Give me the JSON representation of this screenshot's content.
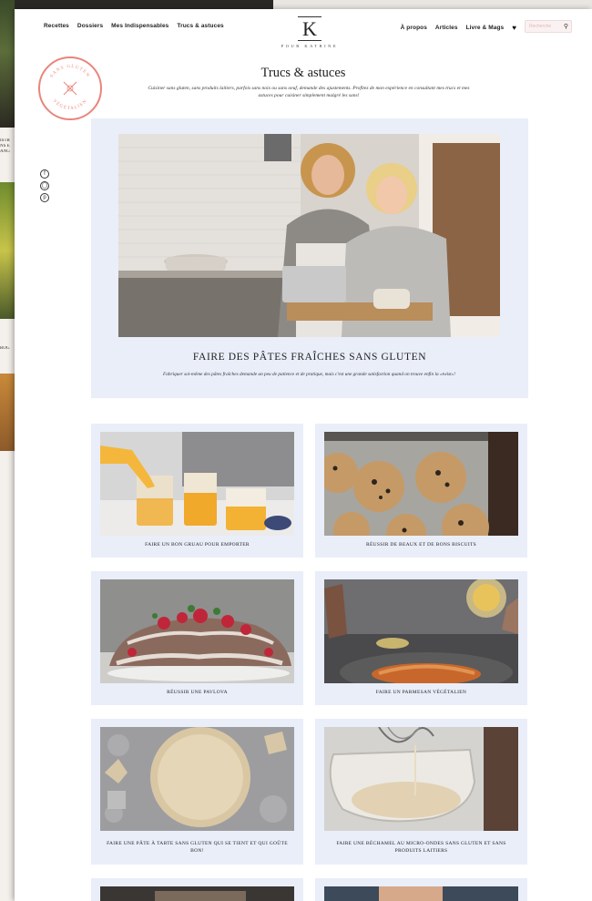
{
  "nav": {
    "left": [
      "Recettes",
      "Dossiers",
      "Mes Indispensables",
      "Trucs & astuces"
    ],
    "right": [
      "À propos",
      "Articles",
      "Livre & Mags"
    ],
    "search_placeholder": "Recherche"
  },
  "logo": {
    "letter": "K",
    "subtitle": "POUR KATRINE"
  },
  "seal": {
    "top_text": "SANS GLUTEN",
    "bottom_text": "VÉGÉTALIEN"
  },
  "social": [
    "facebook-icon",
    "instagram-icon",
    "pinterest-icon"
  ],
  "page": {
    "title": "Trucs & astuces",
    "description": "Cuisiner sans gluten, sans produits laitiers, parfois sans noix ou sans oeuf, demande des ajustements. Profitez de mon expérience en consultant mes trucs et mes astuces pour cuisiner simplement malgré les sans!"
  },
  "hero": {
    "title": "FAIRE DES PÂTES FRAÎCHES SANS GLUTEN",
    "description": "Fabriquer soi-même des pâtes fraîches demande un peu de patience et de pratique, mais c'est une grande satisfaction quand on trouve enfin la «twist»!"
  },
  "cards": [
    {
      "title": "FAIRE UN BON GRUAU POUR EMPORTER"
    },
    {
      "title": "RÉUSSIR DE BEAUX ET DE BONS BISCUITS"
    },
    {
      "title": "RÉUSSIR UNE PAVLOVA"
    },
    {
      "title": "FAIRE UN PARMESAN VÉGÉTALIEN"
    },
    {
      "title": "FAIRE UNE PÂTE À TARTE SANS GLUTEN QUI SE TIENT ET QUI GOÛTE BON!"
    },
    {
      "title": "FAIRE UNE BÉCHAMEL AU MICRO-ONDES SANS GLUTEN ET SANS PRODUITS LAITIERS"
    }
  ],
  "background_page": {
    "snippets": [
      "ISTR",
      "NS E",
      "ANG",
      "ROG"
    ]
  },
  "colors": {
    "card_bg": "#e9eef9",
    "seal": "#e9857c",
    "search_bg": "#faf2f2"
  }
}
